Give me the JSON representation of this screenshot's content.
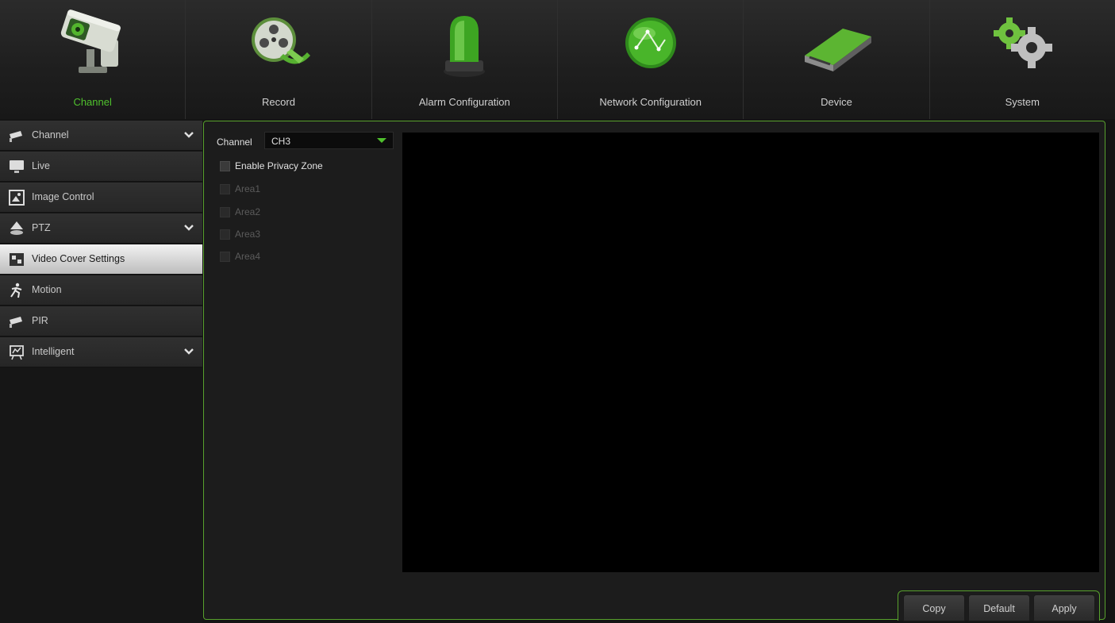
{
  "nav": {
    "tabs": [
      {
        "label": "Channel",
        "icon": "camera-icon",
        "active": true
      },
      {
        "label": "Record",
        "icon": "film-reel-icon",
        "active": false
      },
      {
        "label": "Alarm Configuration",
        "icon": "alarm-beacon-icon",
        "active": false
      },
      {
        "label": "Network Configuration",
        "icon": "network-globe-icon",
        "active": false
      },
      {
        "label": "Device",
        "icon": "hard-drive-icon",
        "active": false
      },
      {
        "label": "System",
        "icon": "gears-icon",
        "active": false
      }
    ]
  },
  "sidebar": {
    "items": [
      {
        "label": "Channel",
        "icon": "camera-small-icon",
        "expandable": true,
        "active": false
      },
      {
        "label": "Live",
        "icon": "monitor-icon",
        "expandable": false,
        "active": false
      },
      {
        "label": "Image Control",
        "icon": "image-control-icon",
        "expandable": false,
        "active": false
      },
      {
        "label": "PTZ",
        "icon": "ptz-icon",
        "expandable": true,
        "active": false
      },
      {
        "label": "Video Cover Settings",
        "icon": "video-cover-icon",
        "expandable": false,
        "active": true
      },
      {
        "label": "Motion",
        "icon": "running-man-icon",
        "expandable": false,
        "active": false
      },
      {
        "label": "PIR",
        "icon": "pir-icon",
        "expandable": false,
        "active": false
      },
      {
        "label": "Intelligent",
        "icon": "intelligent-icon",
        "expandable": true,
        "active": false
      }
    ]
  },
  "content": {
    "channel_label": "Channel",
    "channel_value": "CH3",
    "enable_privacy_zone": "Enable Privacy Zone",
    "areas": [
      "Area1",
      "Area2",
      "Area3",
      "Area4"
    ]
  },
  "buttons": {
    "copy": "Copy",
    "default": "Default",
    "apply": "Apply"
  },
  "colors": {
    "accent_green": "#4fc12d",
    "panel_border": "#58a12d"
  }
}
